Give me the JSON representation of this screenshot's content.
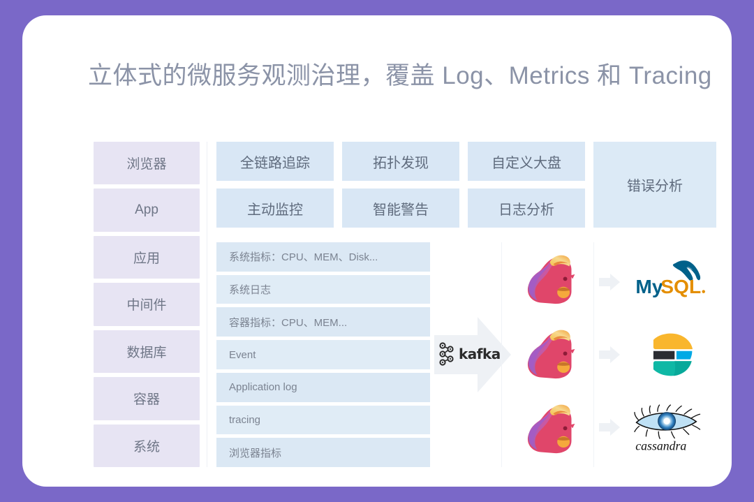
{
  "slide": {
    "title": "立体式的微服务观测治理，覆盖 Log、Metrics 和 Tracing",
    "frame_color": "#7a68c8",
    "card_color": "#ffffff",
    "title_color": "#8b93a7"
  },
  "sidebar": {
    "accent": "#e7e4f3",
    "items": [
      {
        "label": "浏览器"
      },
      {
        "label": "App"
      },
      {
        "label": "应用"
      },
      {
        "label": "中间件"
      },
      {
        "label": "数据库"
      },
      {
        "label": "容器"
      },
      {
        "label": "系统"
      }
    ]
  },
  "features": {
    "accent": "#d9e7f5",
    "boxes": [
      {
        "label": "全链路追踪"
      },
      {
        "label": "拓扑发现"
      },
      {
        "label": "自定义大盘"
      },
      {
        "label": "主动监控"
      },
      {
        "label": "智能警告"
      },
      {
        "label": "日志分析"
      }
    ],
    "tall_box": {
      "label": "错误分析"
    }
  },
  "pipeline": {
    "source_accent": "#dbe8f4",
    "sources": [
      {
        "label": "系统指标：CPU、MEM、Disk..."
      },
      {
        "label": "系统日志"
      },
      {
        "label": "容器指标：CPU、MEM..."
      },
      {
        "label": "Event"
      },
      {
        "label": "Application log"
      },
      {
        "label": "tracing"
      },
      {
        "label": "浏览器指标"
      }
    ],
    "broker": {
      "name": "kafka",
      "icon": "kafka-icon",
      "arrow_color": "#eef1f5"
    },
    "processors": [
      {
        "name": "apache-flink-logo"
      },
      {
        "name": "apache-flink-logo"
      },
      {
        "name": "apache-flink-logo"
      }
    ],
    "connector_arrows": [
      {
        "name": "arrow-right-icon"
      },
      {
        "name": "arrow-right-icon"
      },
      {
        "name": "arrow-right-icon"
      }
    ],
    "stores": [
      {
        "name": "mysql-logo",
        "label": "MySQL"
      },
      {
        "name": "elasticsearch-logo",
        "label": "Elasticsearch"
      },
      {
        "name": "cassandra-logo",
        "label": "cassandra"
      }
    ]
  }
}
